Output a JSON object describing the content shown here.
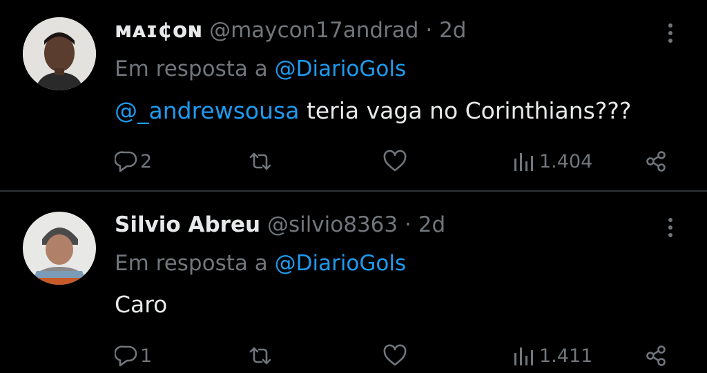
{
  "tweets": [
    {
      "display_name": "ᴍᴀɪ¢ᴏɴ",
      "handle": "@maycon17andrad",
      "separator": "·",
      "time": "2d",
      "reply_prefix": "Em resposta a",
      "reply_to": "@DiarioGols",
      "mention": "@_andrewsousa",
      "text": "teria vaga no Corinthians???",
      "replies": "2",
      "views": "1.404"
    },
    {
      "display_name": "Silvio Abreu",
      "handle": "@silvio8363",
      "separator": "·",
      "time": "2d",
      "reply_prefix": "Em resposta a",
      "reply_to": "@DiarioGols",
      "mention": "",
      "text": "Caro",
      "replies": "1",
      "views": "1.411"
    }
  ],
  "colors": {
    "background": "#000000",
    "text_primary": "#e7e9ea",
    "text_secondary": "#71767b",
    "accent": "#1d9bf0",
    "divider": "#2f3336"
  },
  "icons": {
    "reply": "reply-bubble-icon",
    "retweet": "retweet-icon",
    "like": "heart-icon",
    "views": "views-bar-chart-icon",
    "share": "share-icon",
    "more": "more-vertical-icon"
  }
}
